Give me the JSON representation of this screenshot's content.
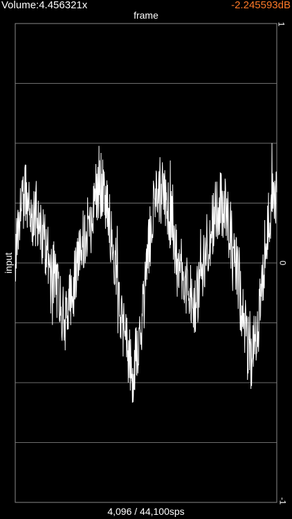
{
  "status": {
    "volume": "Volume:4.456321x",
    "gain": "-2.245593dB",
    "gain_color": "#ff7a28"
  },
  "chart_data": {
    "type": "line",
    "xlabel": "frame",
    "ylabel": "input",
    "ylim": [
      -1,
      1
    ],
    "y_ticks": [
      "1",
      "0",
      "-1"
    ],
    "grid": true,
    "grid_divisions": 8,
    "series": [
      {
        "values": [
          0.05,
          0.22,
          0.28,
          0.18,
          0.21,
          0.15,
          0.08,
          0.0,
          -0.09,
          -0.19,
          -0.24,
          -0.15,
          -0.03,
          0.07,
          0.16,
          0.25,
          0.31,
          0.33,
          0.24,
          0.08,
          -0.1,
          -0.27,
          -0.39,
          -0.45,
          -0.36,
          -0.18,
          0.05,
          0.22,
          0.3,
          0.28,
          0.22,
          0.12,
          0.02,
          -0.07,
          -0.14,
          -0.18,
          -0.1,
          0.02,
          0.12,
          0.2,
          0.24,
          0.22,
          0.12,
          -0.01,
          -0.16,
          -0.3,
          -0.39,
          -0.33,
          -0.12,
          0.1,
          0.25,
          0.28
        ]
      }
    ]
  },
  "footer": {
    "info": "4,096 / 44,100sps"
  }
}
